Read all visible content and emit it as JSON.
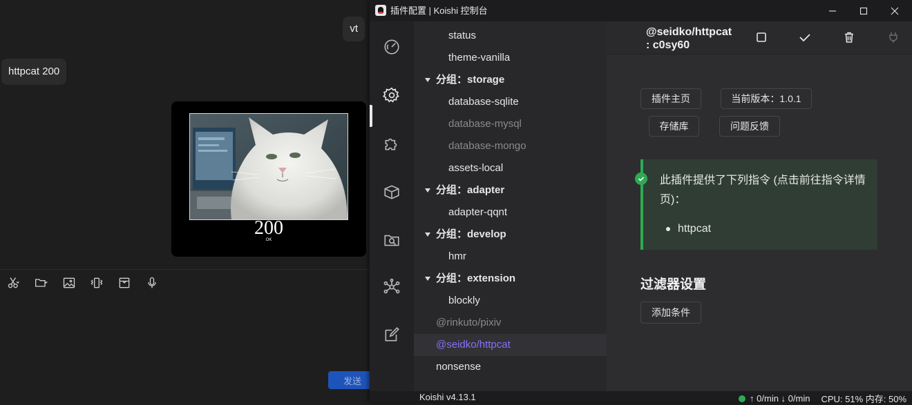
{
  "chat": {
    "messages": {
      "vt": "vt",
      "httpcat": "httpcat 200"
    },
    "image": {
      "code": "200",
      "subtitle": "OK"
    },
    "toolbar": [
      "scissors-icon",
      "folder-icon",
      "image-icon",
      "vibrate-icon",
      "inbox-icon",
      "microphone-icon"
    ],
    "send_label": "发送"
  },
  "koishi": {
    "window_title": "插件配置 | Koishi 控制台",
    "activity_bar": [
      "dashboard-icon",
      "gear-icon",
      "puzzle-icon",
      "box-icon",
      "folder-search-icon",
      "graph-icon",
      "edit-icon"
    ],
    "more": "···",
    "tree": {
      "items": [
        {
          "label": "status",
          "kind": "leaf"
        },
        {
          "label": "theme-vanilla",
          "kind": "leaf"
        },
        {
          "label": "分组：storage",
          "kind": "group"
        },
        {
          "label": "database-sqlite",
          "kind": "leaf"
        },
        {
          "label": "database-mysql",
          "kind": "leaf-disabled"
        },
        {
          "label": "database-mongo",
          "kind": "leaf-disabled"
        },
        {
          "label": "assets-local",
          "kind": "leaf"
        },
        {
          "label": "分组：adapter",
          "kind": "group"
        },
        {
          "label": "adapter-qqnt",
          "kind": "leaf"
        },
        {
          "label": "分组：develop",
          "kind": "group"
        },
        {
          "label": "hmr",
          "kind": "leaf"
        },
        {
          "label": "分组：extension",
          "kind": "group"
        },
        {
          "label": "blockly",
          "kind": "leaf"
        },
        {
          "label": "@rinkuto/pixiv",
          "kind": "root-disabled"
        },
        {
          "label": "@seidko/httpcat",
          "kind": "root-selected"
        },
        {
          "label": "nonsense",
          "kind": "root"
        }
      ]
    },
    "plugin": {
      "title_line1": "@seidko/httpcat",
      "title_line2": ": c0sy60",
      "buttons": {
        "homepage": "插件主页",
        "version": "当前版本：1.0.1",
        "repo": "存储库",
        "issues": "问题反馈"
      },
      "tip_text": "此插件提供了下列指令 (点击前往指令详情页)：",
      "commands": [
        "httpcat"
      ],
      "filter_title": "过滤器设置",
      "add_condition": "添加条件"
    },
    "statusbar": {
      "version": "Koishi v4.13.1",
      "traffic": "↑ 0/min ↓ 0/min",
      "system": "CPU: 51% 内存: 50%"
    }
  }
}
